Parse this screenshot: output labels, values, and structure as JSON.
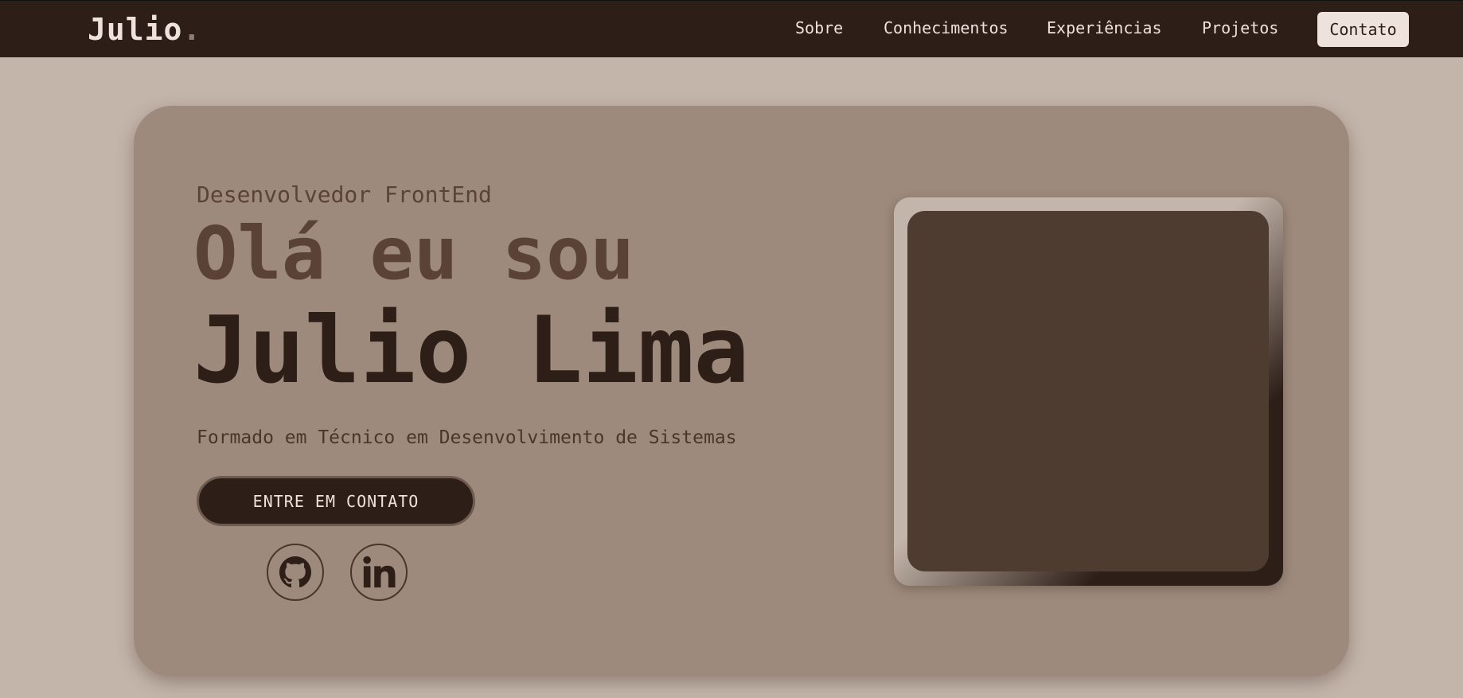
{
  "nav": {
    "logo": "Julio",
    "logo_dot": ".",
    "links": [
      "Sobre",
      "Conhecimentos",
      "Experiências",
      "Projetos"
    ],
    "contact": "Contato"
  },
  "hero": {
    "subtitle": "Desenvolvedor FrontEnd",
    "greeting": "Olá eu sou",
    "name": "Julio Lima",
    "description": "Formado em Técnico em Desenvolvimento de Sistemas",
    "cta": "ENTRE EM CONTATO",
    "socials": [
      "github-icon",
      "linkedin-icon"
    ]
  },
  "colors": {
    "nav_bg": "#2d1e18",
    "page_bg": "#c4b5aa",
    "card_bg": "#9e8a7d",
    "text_dark": "#2d1e18",
    "text_mid": "#5a4336",
    "photo": "#4e3c31"
  }
}
